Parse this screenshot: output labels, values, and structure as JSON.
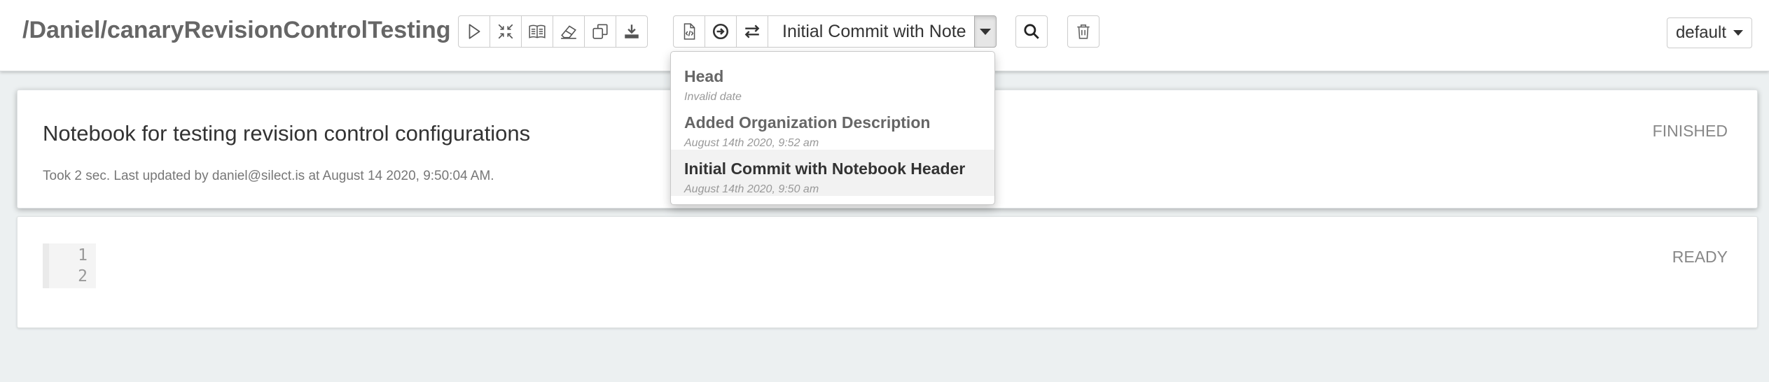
{
  "header": {
    "notebook_title": "/Daniel/canaryRevisionControlTesting",
    "toolbar_icons": [
      "play-icon",
      "collapse-icon",
      "book-icon",
      "eraser-icon",
      "clone-icon",
      "download-icon"
    ],
    "revision_icons": [
      "code-file-icon",
      "arrow-circle-icon",
      "exchange-icon"
    ],
    "selected_revision": "Initial Commit with Note",
    "search_icon": "search-icon",
    "trash_icon": "trash-icon",
    "interpreter_button": "default"
  },
  "revision_dropdown": {
    "items": [
      {
        "title": "Head",
        "date": "Invalid date",
        "active": false
      },
      {
        "title": "Added Organization Description",
        "date": "August 14th 2020, 9:52 am",
        "active": false
      },
      {
        "title": "Initial Commit with Notebook Header",
        "date": "August 14th 2020, 9:50 am",
        "active": true
      }
    ]
  },
  "paragraphs": [
    {
      "title": "Notebook for testing revision control configurations",
      "meta": "Took 2 sec. Last updated by daniel@silect.is at August 14 2020, 9:50:04 AM.",
      "status": "FINISHED"
    },
    {
      "line_numbers": [
        "1",
        "2"
      ],
      "status": "READY"
    }
  ],
  "colors": {
    "page_background": "#ecf0f1",
    "title_gray": "#666666",
    "status_gray": "#888888"
  }
}
